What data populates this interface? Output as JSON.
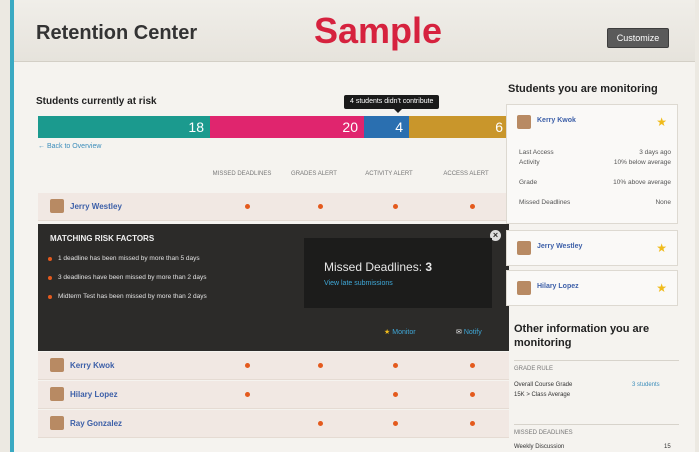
{
  "header": {
    "title": "Retention Center",
    "watermark": "Sample",
    "customize_label": "Customize"
  },
  "risk": {
    "title": "Students currently at risk",
    "tooltip": "4 students didn't contribute",
    "bar": [
      {
        "value": "18",
        "color": "#1b9a8e"
      },
      {
        "value": "20",
        "color": "#e0256e"
      },
      {
        "value": "4",
        "color": "#2a6fb0"
      },
      {
        "value": "6",
        "color": "#c9962b"
      }
    ],
    "back_link": "← Back to Overview",
    "columns": [
      "MISSED DEADLINES",
      "GRADES ALERT",
      "ACTIVITY ALERT",
      "ACCESS ALERT"
    ],
    "rows": [
      {
        "name": "Jerry Westley"
      },
      {
        "name": "Kerry Kwok"
      },
      {
        "name": "Hilary Lopez"
      },
      {
        "name": "Ray Gonzalez"
      }
    ]
  },
  "detail": {
    "header": "MATCHING RISK FACTORS",
    "factors": [
      "1 deadline has been missed by more than 5 days",
      "3 deadlines have been missed by more than 2 days",
      "Midterm Test has been missed by more than 2 days"
    ],
    "missed_label": "Missed Deadlines:",
    "missed_value": "3",
    "view_link": "View late submissions",
    "monitor_label": "Monitor",
    "notify_label": "Notify"
  },
  "monitoring": {
    "title": "Students you are monitoring",
    "primary": {
      "name": "Kerry Kwok",
      "fields": [
        {
          "label": "Last Access",
          "value": "3 days ago"
        },
        {
          "label": "Activity",
          "value": "10% below average"
        },
        {
          "label": "Grade",
          "value": "10% above average"
        },
        {
          "label": "Missed Deadlines",
          "value": "None"
        }
      ]
    },
    "others": [
      {
        "name": "Jerry Westley"
      },
      {
        "name": "Hilary Lopez"
      }
    ]
  },
  "other_info": {
    "title": "Other information you are monitoring",
    "grade_rule_header": "GRADE RULE",
    "grade_rule_label": "Overall Course Grade",
    "grade_rule_sub": "15K > Class Average",
    "grade_rule_value": "3 students",
    "missed_header": "MISSED DEADLINES",
    "missed_item": "Weekly Discussion",
    "missed_count": "15"
  }
}
